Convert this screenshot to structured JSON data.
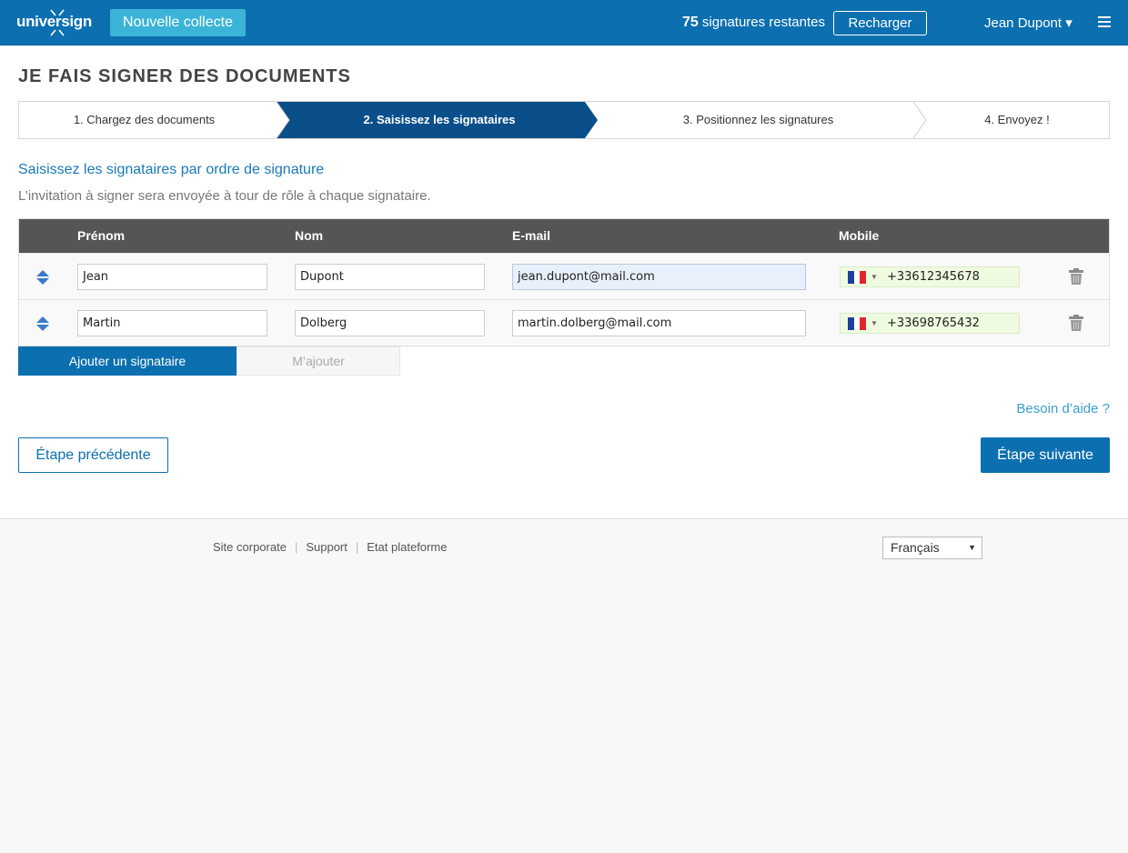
{
  "header": {
    "logo_text": "universign",
    "new_button": "Nouvelle collecte",
    "signature_count": "75",
    "signature_label": "signatures restantes",
    "recharge_button": "Recharger",
    "user_name": "Jean Dupont ▾"
  },
  "page": {
    "title": "Je fais signer des documents",
    "steps": [
      {
        "label": "1. Chargez des documents"
      },
      {
        "label": "2. Saisissez les signataires"
      },
      {
        "label": "3. Positionnez les signatures"
      },
      {
        "label": "4. Envoyez !"
      }
    ],
    "subtitle": "Saisissez les signataires par ordre de signature",
    "description": "L’invitation à signer sera envoyée à tour de rôle à chaque signataire."
  },
  "table": {
    "headers": {
      "firstname": "Prénom",
      "lastname": "Nom",
      "email": "E-mail",
      "mobile": "Mobile"
    },
    "rows": [
      {
        "firstname": "Jean",
        "lastname": "Dupont",
        "email": "jean.dupont@mail.com",
        "phone": "+33612345678"
      },
      {
        "firstname": "Martin",
        "lastname": "Dolberg",
        "email": "martin.dolberg@mail.com",
        "phone": "+33698765432"
      }
    ]
  },
  "actions": {
    "add_signer": "Ajouter un signataire",
    "add_me": "M’ajouter",
    "help": "Besoin d’aide ?",
    "previous": "Étape précédente",
    "next": "Étape suivante"
  },
  "footer": {
    "links": [
      "Site corporate",
      "Support",
      "Etat plateforme"
    ],
    "language": "Français"
  },
  "colors": {
    "primary": "#0c6fb0",
    "accent": "#3cb4d8",
    "active_step": "#0b4f8a",
    "table_header": "#555555"
  }
}
